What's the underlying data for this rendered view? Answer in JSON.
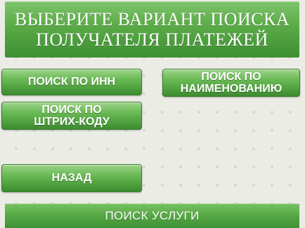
{
  "header": {
    "line1": "ВЫБЕРИТЕ ВАРИАНТ ПОИСКА",
    "line2": "ПОЛУЧАТЕЛЯ ПЛАТЕЖЕЙ"
  },
  "buttons": {
    "inn": "ПОИСК ПО ИНН",
    "name_line1": "ПОИСК ПО",
    "name_line2": "НАИМЕНОВАНИЮ",
    "barcode_line1": "ПОИСК ПО",
    "barcode_line2": "ШТРИХ-КОДУ",
    "back": "НАЗАД"
  },
  "footer": {
    "label": "ПОИСК УСЛУГИ"
  },
  "colors": {
    "accent_green": "#4e9f3e",
    "background": "#ecece6",
    "text": "#ffffff"
  }
}
